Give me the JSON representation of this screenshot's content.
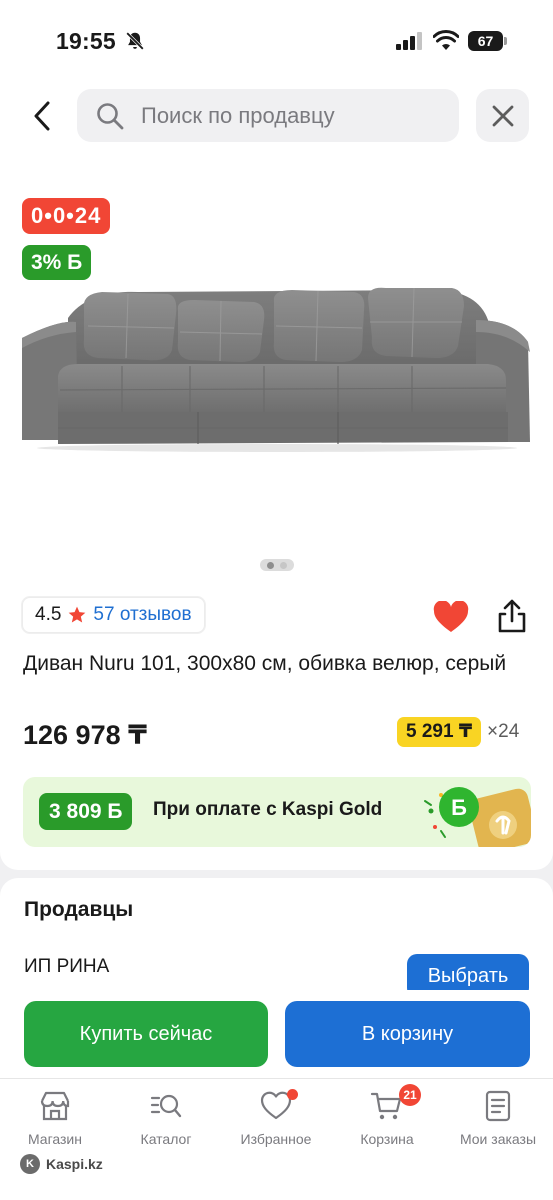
{
  "status_bar": {
    "time": "19:55",
    "battery": "67"
  },
  "header": {
    "search_placeholder": "Поиск по продавцу"
  },
  "product": {
    "timer": "0•0•24",
    "bonus_badge": "3% Б",
    "rating": "4.5",
    "reviews": "57 отзывов",
    "title": "Диван Nuru 101, 300x80 см, обивка велюр, серый",
    "price": "126 978 ₸",
    "installment_amount": "5 291 ₸",
    "installment_months": "×24",
    "image_pages": 2,
    "image_current": 1
  },
  "kaspi_gold": {
    "bonus": "3 809 Б",
    "text": "При оплате с Kaspi Gold"
  },
  "sellers": {
    "title": "Продавцы",
    "first_seller": "ИП РИНА",
    "choose_label": "Выбрать"
  },
  "actions": {
    "buy_now": "Купить сейчас",
    "add_to_cart": "В корзину"
  },
  "tab_bar": {
    "items": [
      {
        "label": "Магазин",
        "icon": "store-icon"
      },
      {
        "label": "Каталог",
        "icon": "catalog-search-icon"
      },
      {
        "label": "Избранное",
        "icon": "heart-outline-icon"
      },
      {
        "label": "Корзина",
        "icon": "cart-icon",
        "badge": "21"
      },
      {
        "label": "Мои заказы",
        "icon": "orders-icon"
      }
    ]
  },
  "watermark": "Kaspi.kz",
  "colors": {
    "red": "#f14635",
    "green": "#2a9b2a",
    "blue": "#1d6fd4",
    "yellow": "#f9d423",
    "link": "#1f6fd1"
  }
}
